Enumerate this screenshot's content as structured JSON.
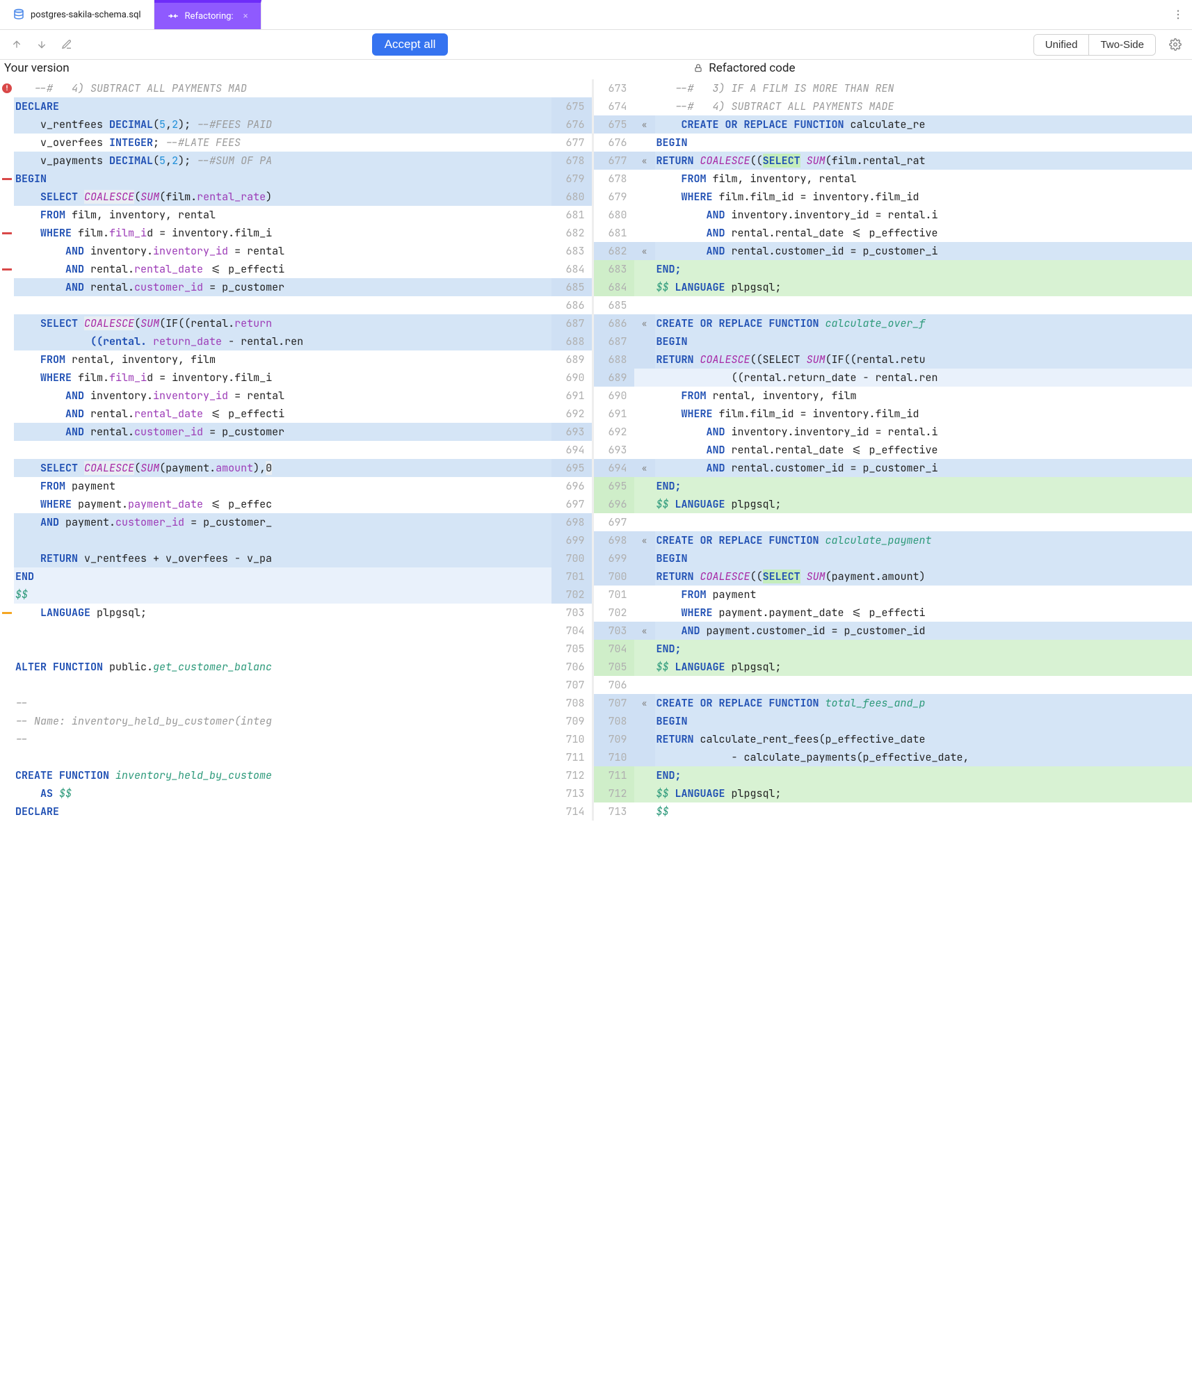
{
  "tabs": {
    "file_tab": "postgres-sakila-schema.sql",
    "refactor_tab": "Refactoring:"
  },
  "toolbar": {
    "accept_all": "Accept all",
    "unified": "Unified",
    "two_side": "Two-Side"
  },
  "headers": {
    "left": "Your version",
    "right": "Refactored code"
  },
  "left": [
    {
      "n": "",
      "marker": "err",
      "bg": "",
      "text": "   --#   4) SUBTRACT ALL PAYMENTS MAD",
      "cls": "comment"
    },
    {
      "n": "675",
      "bg": "blue",
      "text": "DECLARE",
      "cls": "kw"
    },
    {
      "n": "676",
      "bg": "blue",
      "ind": 1,
      "text": "v_rentfees ",
      "tail": "DECIMAL(5,2); --#FEES PAID"
    },
    {
      "n": "677",
      "bg": "",
      "ind": 1,
      "text": "v_overfees ",
      "tail": "INTEGER;      --#LATE FEES"
    },
    {
      "n": "678",
      "bg": "blue",
      "ind": 1,
      "text": "v_payments ",
      "tail": "DECIMAL(5,2); --#SUM OF PA"
    },
    {
      "n": "679",
      "marker": "red",
      "bg": "blue",
      "text": "BEGIN",
      "cls": "kw"
    },
    {
      "n": "680",
      "bg": "blue",
      "ind": 1,
      "text": "SELECT ",
      "coalesce": "COALESCE",
      "args": "(SUM(film.rental_rate)"
    },
    {
      "n": "681",
      "bg": "",
      "ind": 1,
      "text": "FROM film, inventory, rental"
    },
    {
      "n": "682",
      "marker": "red",
      "bg": "",
      "ind": 1,
      "text": "WHERE film.film_id = inventory.film_i"
    },
    {
      "n": "683",
      "bg": "",
      "ind": 2,
      "text": "AND inventory.",
      "id": "inventory_id",
      "rest": " = rental"
    },
    {
      "n": "684",
      "marker": "red",
      "bg": "",
      "ind": 2,
      "text": "AND rental.",
      "id": "rental_date",
      "rest": " <= p_effecti"
    },
    {
      "n": "685",
      "bg": "blue",
      "ind": 2,
      "text": "AND rental.",
      "id": "customer_id",
      "rest": " = p_customer"
    },
    {
      "n": "686",
      "bg": "",
      "text": ""
    },
    {
      "n": "687",
      "bg": "blue",
      "ind": 1,
      "text": "SELECT ",
      "coalesce": "COALESCE",
      "args": "(SUM(IF((rental.return"
    },
    {
      "n": "688",
      "bg": "blue",
      "ind": 3,
      "text": "((rental.",
      "id": "return_date",
      "rest": " - rental.ren"
    },
    {
      "n": "689",
      "bg": "",
      "ind": 1,
      "text": "FROM rental, inventory, film"
    },
    {
      "n": "690",
      "bg": "",
      "ind": 1,
      "text": "WHERE film.film_id = inventory.film_i"
    },
    {
      "n": "691",
      "bg": "",
      "ind": 2,
      "text": "AND inventory.",
      "id": "inventory_id",
      "rest": " = rental"
    },
    {
      "n": "692",
      "bg": "",
      "ind": 2,
      "text": "AND rental.",
      "id": "rental_date",
      "rest": " <= p_effecti"
    },
    {
      "n": "693",
      "bg": "blue",
      "ind": 2,
      "text": "AND rental.",
      "id": "customer_id",
      "rest": " = p_customer"
    },
    {
      "n": "694",
      "bg": "",
      "text": ""
    },
    {
      "n": "695",
      "bg": "blue",
      "ind": 1,
      "text": "SELECT ",
      "coalesce": "COALESCE",
      "args": "(SUM(payment.amount),0"
    },
    {
      "n": "696",
      "bg": "",
      "ind": 1,
      "text": "FROM payment"
    },
    {
      "n": "697",
      "bg": "",
      "ind": 1,
      "text": "WHERE payment.",
      "id": "payment_date",
      "rest": " <= p_effec"
    },
    {
      "n": "698",
      "bg": "blue",
      "ind": 1,
      "text": "AND payment.",
      "id": "customer_id",
      "rest": " = p_customer_"
    },
    {
      "n": "699",
      "bg": "blue",
      "text": ""
    },
    {
      "n": "700",
      "bg": "blue",
      "ind": 1,
      "text": "RETURN ",
      "rest": "v_rentfees + v_overfees - v_pa"
    },
    {
      "n": "701",
      "bg": "lblue",
      "text": "END",
      "cls": "kw"
    },
    {
      "n": "702",
      "bg": "lblue",
      "text": "$$",
      "cls": "funcname"
    },
    {
      "n": "703",
      "marker": "orange",
      "bg": "",
      "ind": 1,
      "text": "LANGUAGE plpgsql;"
    },
    {
      "n": "704",
      "bg": "",
      "text": ""
    },
    {
      "n": "705",
      "bg": "",
      "text": ""
    },
    {
      "n": "706",
      "bg": "",
      "text": "ALTER FUNCTION ",
      "rest": "public.get_customer_balanc"
    },
    {
      "n": "707",
      "bg": "",
      "text": ""
    },
    {
      "n": "708",
      "bg": "",
      "text": "--",
      "cls": "comment"
    },
    {
      "n": "709",
      "bg": "",
      "text": "-- Name: inventory_held_by_customer(integ",
      "cls": "comment"
    },
    {
      "n": "710",
      "bg": "",
      "text": "--",
      "cls": "comment"
    },
    {
      "n": "711",
      "bg": "",
      "text": ""
    },
    {
      "n": "712",
      "bg": "",
      "text": "CREATE FUNCTION ",
      "fn": "inventory_held_by_custome"
    },
    {
      "n": "713",
      "bg": "",
      "ind": 1,
      "text": "AS ",
      "rest": "$$"
    },
    {
      "n": "714",
      "bg": "",
      "text": "DECLARE",
      "cls": "kw"
    }
  ],
  "right": [
    {
      "n": "674",
      "bg": "",
      "text": "   --#   3) IF A FILM IS MORE THAN REN",
      "cls": "comment"
    },
    {
      "n": "674b",
      "real": "674",
      "bg": "",
      "text": "   --#   4) SUBTRACT ALL PAYMENTS MADE",
      "cls": "comment"
    },
    {
      "n": "675",
      "bg": "blue",
      "chev": true,
      "ind": 1,
      "text": "CREATE OR REPLACE FUNCTION ",
      "rest": "calculate_re"
    },
    {
      "n": "676",
      "bg": "",
      "text": "BEGIN",
      "cls": "kw"
    },
    {
      "n": "677",
      "bg": "blue",
      "chev": true,
      "text": "RETURN ",
      "coal": "COALESCE((",
      "sel": "SELECT ",
      "args": "SUM(film.rental_rat"
    },
    {
      "n": "678",
      "bg": "",
      "ind": 1,
      "text": "FROM film, inventory, rental"
    },
    {
      "n": "679",
      "bg": "",
      "ind": 1,
      "text": "WHERE film.film_id = inventory.film_id"
    },
    {
      "n": "680",
      "bg": "",
      "ind": 2,
      "text": "AND inventory.inventory_id = rental.i"
    },
    {
      "n": "681",
      "bg": "",
      "ind": 2,
      "text": "AND rental.rental_date <= p_effective"
    },
    {
      "n": "682",
      "bg": "blue",
      "chev": true,
      "ind": 2,
      "text": "AND rental.customer_id = p_customer_i"
    },
    {
      "n": "683",
      "bg": "green",
      "text": "END;",
      "cls": "kw"
    },
    {
      "n": "684",
      "bg": "green",
      "text": "$$ LANGUAGE plpgsql;",
      "cls": "lang"
    },
    {
      "n": "685",
      "bg": "",
      "text": ""
    },
    {
      "n": "686",
      "bg": "blue",
      "chev": true,
      "text": "CREATE OR REPLACE FUNCTION ",
      "fn": "calculate_over_f"
    },
    {
      "n": "687",
      "bg": "blue",
      "text": "BEGIN",
      "cls": "kw"
    },
    {
      "n": "688",
      "bg": "blue",
      "text": "RETURN ",
      "coal": "COALESCE((SELECT ",
      "args": "SUM(IF((rental.retu"
    },
    {
      "n": "689",
      "bg": "lblue",
      "ind": 3,
      "text": "((rental.return_date - rental.ren"
    },
    {
      "n": "690",
      "bg": "",
      "ind": 1,
      "text": "FROM rental, inventory, film"
    },
    {
      "n": "691",
      "bg": "",
      "ind": 1,
      "text": "WHERE film.film_id = inventory.film_id"
    },
    {
      "n": "692",
      "bg": "",
      "ind": 2,
      "text": "AND inventory.inventory_id = rental.i"
    },
    {
      "n": "693",
      "bg": "",
      "ind": 2,
      "text": "AND rental.rental_date <= p_effective"
    },
    {
      "n": "694",
      "bg": "blue",
      "chev": true,
      "ind": 2,
      "text": "AND rental.customer_id = p_customer_i"
    },
    {
      "n": "695",
      "bg": "green",
      "text": "END;",
      "cls": "kw"
    },
    {
      "n": "696",
      "bg": "green",
      "text": "$$ LANGUAGE plpgsql;",
      "cls": "lang"
    },
    {
      "n": "697",
      "bg": "",
      "text": ""
    },
    {
      "n": "698",
      "bg": "blue",
      "chev": true,
      "text": "CREATE OR REPLACE FUNCTION ",
      "fn": "calculate_payment"
    },
    {
      "n": "699",
      "bg": "blue",
      "text": "BEGIN",
      "cls": "kw"
    },
    {
      "n": "700",
      "bg": "blue",
      "text": "RETURN ",
      "coal": "COALESCE((",
      "sel": "SELECT ",
      "args": "SUM(payment.amount)"
    },
    {
      "n": "701",
      "bg": "",
      "ind": 1,
      "text": "FROM payment"
    },
    {
      "n": "702",
      "bg": "",
      "ind": 1,
      "text": "WHERE payment.payment_date <= p_effecti"
    },
    {
      "n": "703",
      "bg": "blue",
      "chev": true,
      "ind": 1,
      "text": "AND payment.customer_id = p_customer_id"
    },
    {
      "n": "704",
      "bg": "green",
      "text": "END;",
      "cls": "kw"
    },
    {
      "n": "705",
      "bg": "green",
      "text": "$$ LANGUAGE plpgsql;",
      "cls": "lang"
    },
    {
      "n": "706",
      "bg": "",
      "text": ""
    },
    {
      "n": "707",
      "bg": "blue",
      "chev": true,
      "text": "CREATE OR REPLACE FUNCTION ",
      "fn": "total_fees_and_p"
    },
    {
      "n": "708",
      "bg": "blue",
      "text": "BEGIN",
      "cls": "kw"
    },
    {
      "n": "709",
      "bg": "blue",
      "text": "RETURN ",
      "rest": "calculate_rent_fees(p_effective_date"
    },
    {
      "n": "710",
      "bg": "blue",
      "ind": 3,
      "text": "- calculate_payments(p_effective_date,"
    },
    {
      "n": "711",
      "bg": "green",
      "text": "END;",
      "cls": "kw"
    },
    {
      "n": "712",
      "bg": "green",
      "text": "$$ LANGUAGE plpgsql;",
      "cls": "lang"
    },
    {
      "n": "713",
      "bg": "",
      "text": "$$",
      "cls": "funcname"
    }
  ],
  "rnum_map": [
    "673",
    "674",
    "675",
    "676",
    "677",
    "678",
    "679",
    "680",
    "681",
    "682",
    "683",
    "684",
    "685",
    "686",
    "687",
    "688",
    "689",
    "690",
    "691",
    "692",
    "693",
    "694",
    "695",
    "696",
    "697",
    "698",
    "699",
    "700",
    "701",
    "702",
    "703",
    "704",
    "705",
    "706",
    "707",
    "708",
    "709",
    "710",
    "711",
    "712",
    "713"
  ]
}
